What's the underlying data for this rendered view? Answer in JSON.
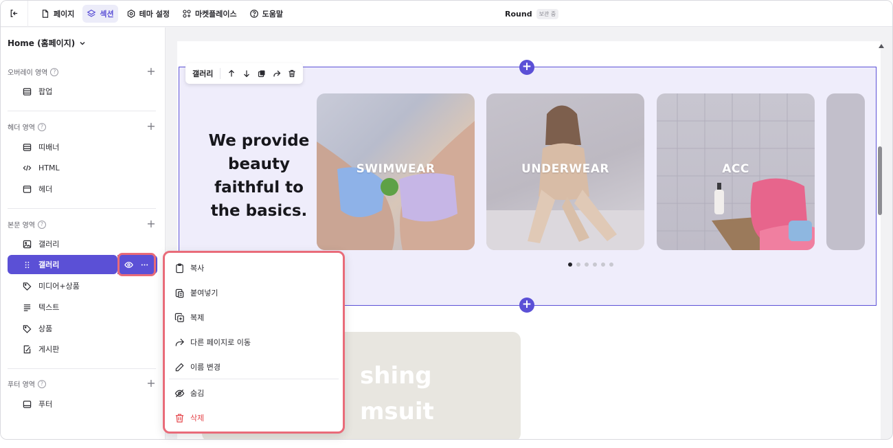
{
  "topbar": {
    "nav": [
      {
        "label": "페이지",
        "icon": "page-icon"
      },
      {
        "label": "섹션",
        "icon": "layers-icon",
        "active": true
      },
      {
        "label": "테마 설정",
        "icon": "gear-icon"
      },
      {
        "label": "마켓플레이스",
        "icon": "apps-icon"
      },
      {
        "label": "도움말",
        "icon": "help-icon"
      }
    ],
    "site_title": "Round",
    "save_status": "보관 중"
  },
  "sidebar": {
    "page_select": "Home (홈페이지)",
    "sections": [
      {
        "title": "오버레이 영역",
        "items": [
          {
            "label": "팝업",
            "icon": "popup-icon"
          }
        ]
      },
      {
        "title": "헤더 영역",
        "items": [
          {
            "label": "띠배너",
            "icon": "banner-icon"
          },
          {
            "label": "HTML",
            "icon": "code-icon"
          },
          {
            "label": "헤더",
            "icon": "header-icon"
          }
        ]
      },
      {
        "title": "본문 영역",
        "items": [
          {
            "label": "갤러리",
            "icon": "image-icon"
          },
          {
            "label": "갤러리",
            "icon": "drag-icon",
            "selected": true
          },
          {
            "label": "미디어+상품",
            "icon": "tag-icon"
          },
          {
            "label": "텍스트",
            "icon": "text-icon"
          },
          {
            "label": "상품",
            "icon": "tag-icon"
          },
          {
            "label": "게시판",
            "icon": "board-icon"
          }
        ]
      },
      {
        "title": "푸터 영역",
        "items": [
          {
            "label": "푸터",
            "icon": "footer-icon"
          }
        ]
      }
    ]
  },
  "canvas": {
    "toolbar_label": "갤러리",
    "headline": "We provide beauty faithful to the basics.",
    "cards": [
      {
        "label": "SWIMWEAR"
      },
      {
        "label": "UNDERWEAR"
      },
      {
        "label": "ACC"
      }
    ],
    "dots": {
      "count": 6,
      "active": 0
    },
    "below_text_1": "shing",
    "below_text_2": "msuit"
  },
  "context_menu": {
    "items": [
      "복사",
      "붙여넣기",
      "복제",
      "다른 페이지로 이동",
      "이름 변경"
    ],
    "hide": "숨김",
    "delete": "삭제"
  },
  "colors": {
    "accent": "#5b50d6",
    "highlight": "#e96b79",
    "danger": "#e5484d"
  }
}
